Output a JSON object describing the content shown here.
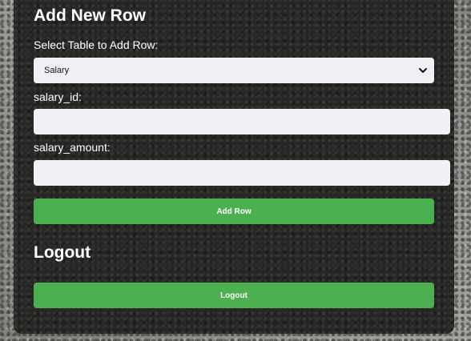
{
  "add_row": {
    "heading": "Add New Row",
    "select_label": "Select Table to Add Row:",
    "selected_table": "Salary",
    "fields": [
      {
        "label": "salary_id:",
        "value": "",
        "placeholder": ""
      },
      {
        "label": "salary_amount:",
        "value": "",
        "placeholder": ""
      }
    ],
    "submit_label": "Add Row"
  },
  "logout": {
    "heading": "Logout",
    "button_label": "Logout"
  },
  "colors": {
    "button": "#4caf50",
    "panel": "#262624",
    "input_bg": "#f0f1f5"
  },
  "icons": {
    "select_arrow": "chevron-down-icon"
  }
}
